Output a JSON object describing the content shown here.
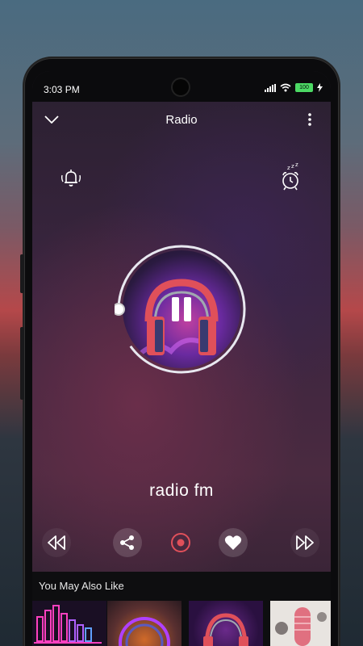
{
  "status_bar": {
    "time": "3:03 PM",
    "battery": "100"
  },
  "header": {
    "title": "Radio"
  },
  "player": {
    "station_name": "radio fm",
    "progress_fraction": 0.9
  },
  "icons": {
    "back": "chevron-down-icon",
    "menu": "more-vert-icon",
    "alarm": "bell-icon",
    "sleep": "sleep-timer-icon",
    "rewind": "rewind-icon",
    "share": "share-icon",
    "record": "record-icon",
    "favorite": "heart-icon",
    "forward": "fast-forward-icon",
    "play_pause": "pause-icon"
  },
  "colors": {
    "accent": "#e0505a",
    "ring": "#e8e8f0",
    "bg_dark": "#0e0e10"
  },
  "recommendations": {
    "heading": "You May Also Like",
    "items": [
      {
        "icon": "equalizer-thumb"
      },
      {
        "icon": "ring-light-thumb"
      },
      {
        "icon": "headphones-thumb"
      },
      {
        "icon": "microphone-thumb"
      }
    ]
  }
}
